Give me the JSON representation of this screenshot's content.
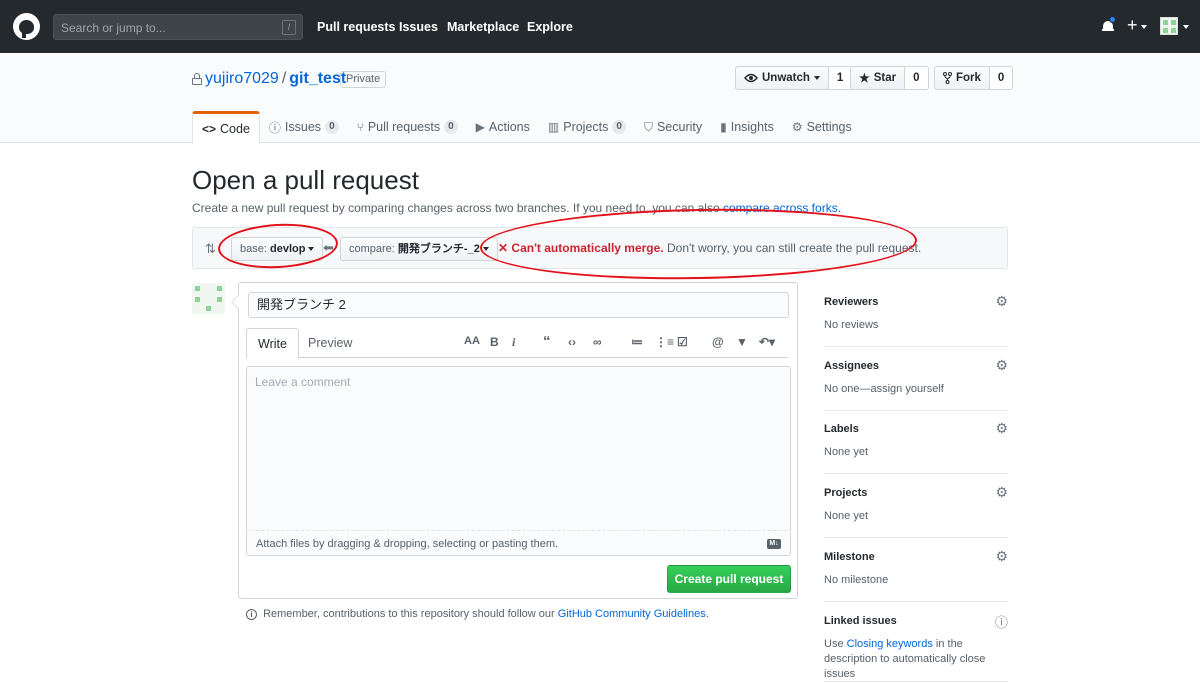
{
  "header": {
    "search_placeholder": "Search or jump to...",
    "search_key": "/",
    "nav": [
      "Pull requests",
      "Issues",
      "Marketplace",
      "Explore"
    ],
    "plus": "+"
  },
  "repo": {
    "owner": "yujiro7029",
    "separator": "/",
    "name": "git_test",
    "visibility": "Private",
    "unwatch_label": "Unwatch",
    "watch_count": "1",
    "star_label": "Star",
    "star_count": "0",
    "fork_label": "Fork",
    "fork_count": "0"
  },
  "tabs": [
    {
      "label": "Code",
      "icon": "code-icon"
    },
    {
      "label": "Issues",
      "count": "0",
      "icon": "issue-icon"
    },
    {
      "label": "Pull requests",
      "count": "0",
      "icon": "pull-request-icon"
    },
    {
      "label": "Actions",
      "icon": "play-icon"
    },
    {
      "label": "Projects",
      "count": "0",
      "icon": "project-icon"
    },
    {
      "label": "Security",
      "icon": "shield-icon"
    },
    {
      "label": "Insights",
      "icon": "graph-icon"
    },
    {
      "label": "Settings",
      "icon": "gear-icon"
    }
  ],
  "page": {
    "title": "Open a pull request",
    "subtitle_prefix": "Create a new pull request by comparing changes across two branches. If you need to, you can also",
    "subtitle_link": "compare across forks",
    "subtitle_suffix": "."
  },
  "range": {
    "base_label": "base:",
    "base_value": "devlop",
    "compare_label": "compare:",
    "compare_value": "開発ブランチ-_2",
    "merge_status": "Can't automatically merge.",
    "merge_note": "Don't worry, you can still create the pull request."
  },
  "form": {
    "title_value": "開発ブランチ 2",
    "write_tab": "Write",
    "preview_tab": "Preview",
    "comment_placeholder": "Leave a comment",
    "attach_text": "Attach files by dragging & dropping, selecting or pasting them.",
    "markdown_badge": "M↓",
    "submit_label": "Create pull request"
  },
  "remember": {
    "prefix": "Remember, contributions to this repository should follow our",
    "link": "GitHub Community Guidelines",
    "suffix": "."
  },
  "sidebar": {
    "reviewers": {
      "title": "Reviewers",
      "value": "No reviews"
    },
    "assignees": {
      "title": "Assignees",
      "value": "No one—assign yourself"
    },
    "labels": {
      "title": "Labels",
      "value": "None yet"
    },
    "projects": {
      "title": "Projects",
      "value": "None yet"
    },
    "milestone": {
      "title": "Milestone",
      "value": "No milestone"
    },
    "linked": {
      "title": "Linked issues",
      "value_prefix": "Use",
      "value_link": "Closing keywords",
      "value_suffix": "in the description to automatically close issues"
    }
  },
  "colors": {
    "accent": "#0366d6",
    "danger": "#cb2431",
    "success": "#28a745",
    "annotation": "#e3111a",
    "header_bg": "#24292e"
  }
}
